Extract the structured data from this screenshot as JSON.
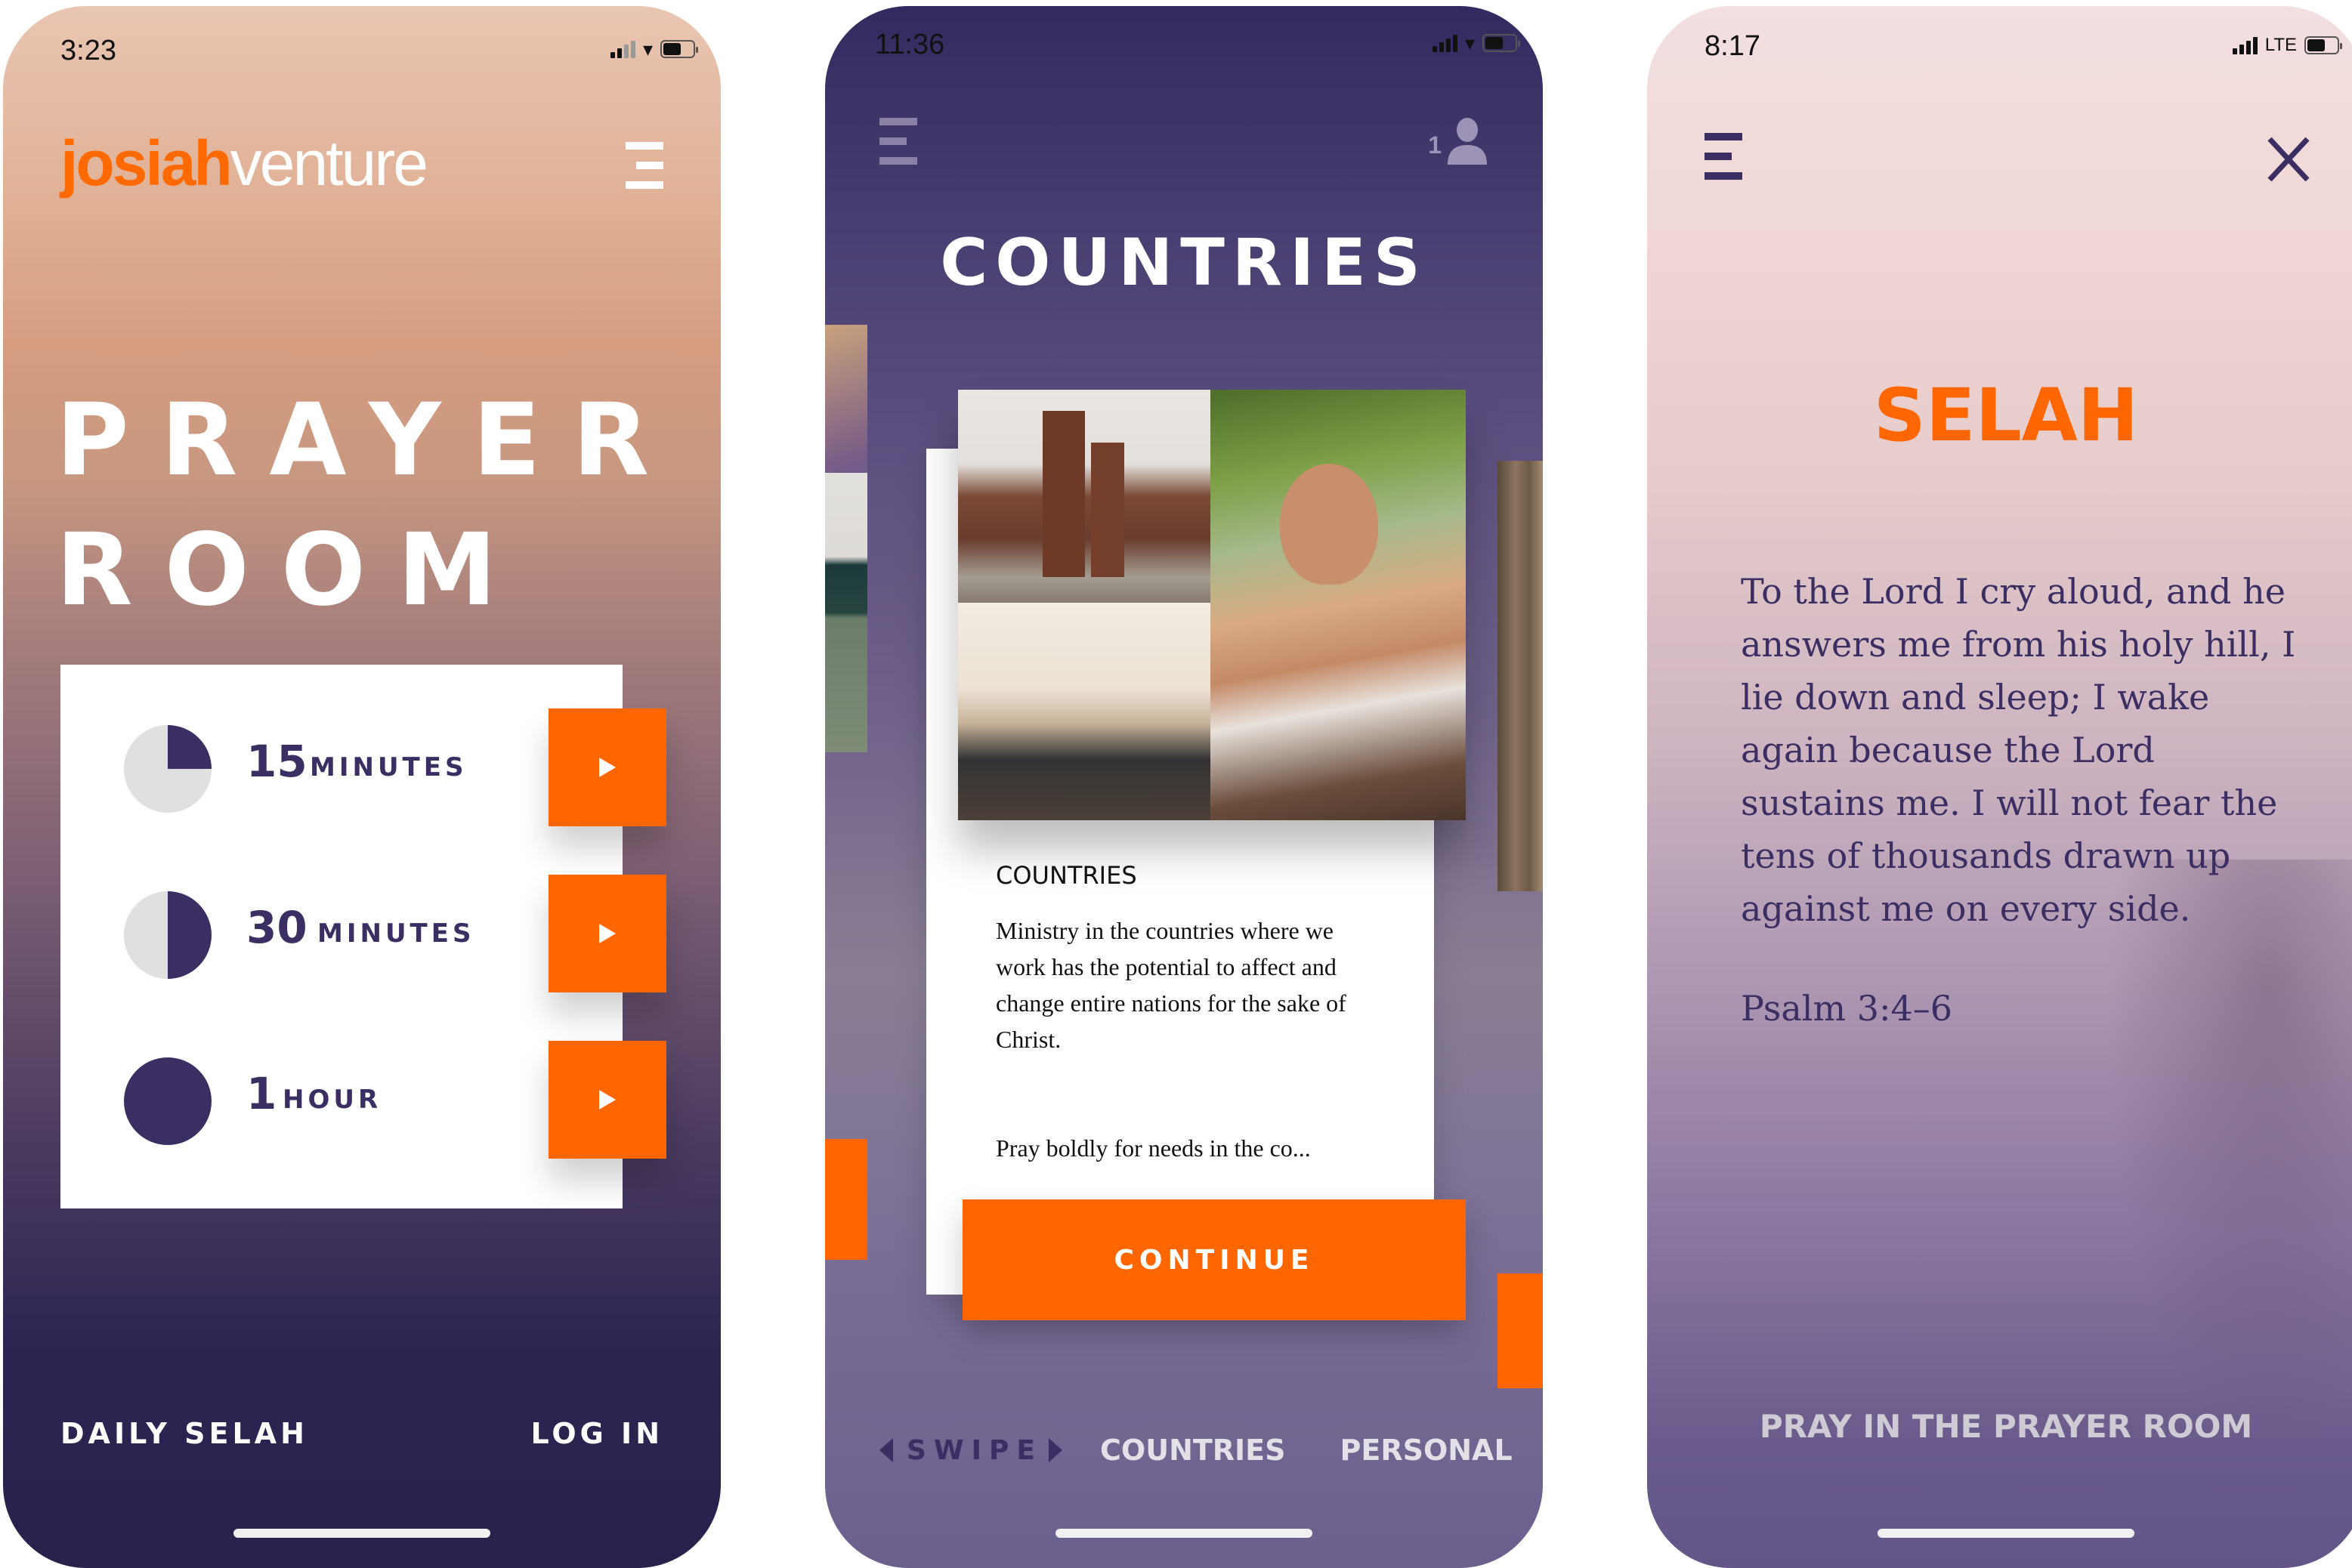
{
  "brand": {
    "accent": "#ff6600",
    "primary": "#3a2e63"
  },
  "screens": [
    {
      "status": {
        "time": "3:23",
        "network": "wifi"
      },
      "logo": {
        "part1": "josiah",
        "part2": "venture"
      },
      "title_line1": "PRAYER",
      "title_line2": "ROOM",
      "options": [
        {
          "number": "15",
          "unit": "MINUTES",
          "fraction": 0.25
        },
        {
          "number": "30",
          "unit": "MINUTES",
          "fraction": 0.5
        },
        {
          "number": "1",
          "unit": "HOUR",
          "fraction": 1.0
        }
      ],
      "footer": {
        "left": "DAILY SELAH",
        "right": "LOG IN"
      }
    },
    {
      "status": {
        "time": "11:36",
        "network": "wifi"
      },
      "user_count": "1",
      "title": "COUNTRIES",
      "card": {
        "heading": "COUNTRIES",
        "body": "Ministry in the countries where we work has the potential to affect and change entire nations for the sake of Christ.",
        "more": "Pray boldly for needs in the co..."
      },
      "continue_label": "CONTINUE",
      "bottom_nav": {
        "swipe": "SWIPE",
        "tabs": [
          "COUNTRIES",
          "PERSONAL"
        ]
      }
    },
    {
      "status": {
        "time": "8:17",
        "network": "LTE"
      },
      "title": "SELAH",
      "verse": "To the Lord I cry aloud, and he answers me from his holy hill, I lie down and sleep; I wake again because the Lord sustains me. I will not fear the tens of thousands drawn up against me on every side.",
      "reference": "Psalm 3:4–6",
      "cta": "PRAY IN THE PRAYER ROOM"
    }
  ]
}
